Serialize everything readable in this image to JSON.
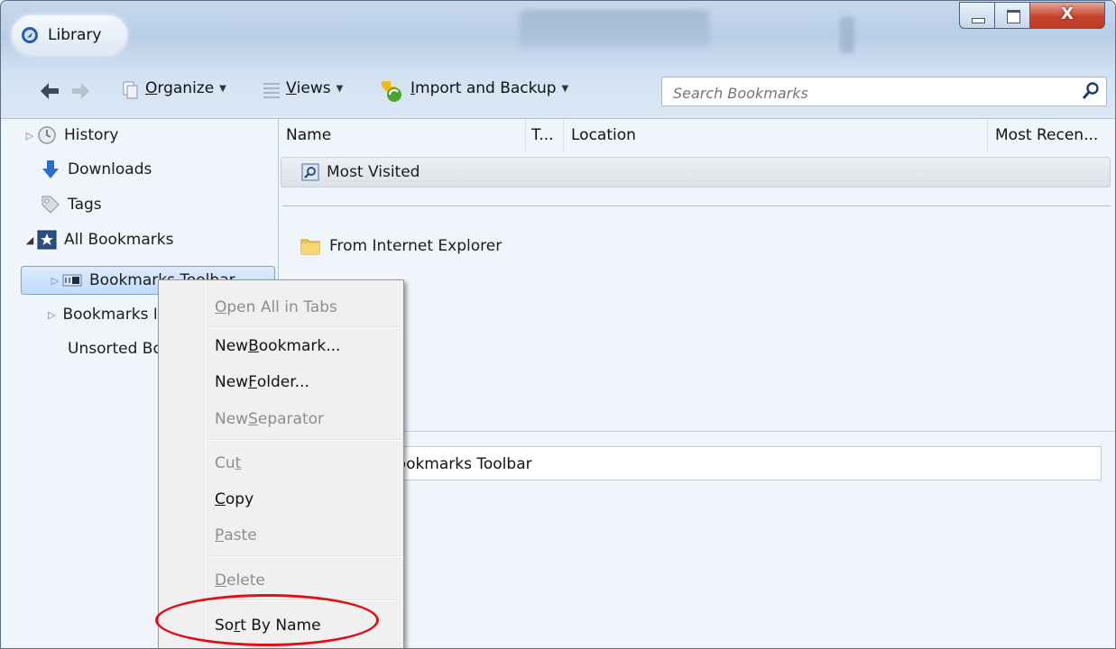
{
  "window": {
    "title": "Library",
    "controls": {
      "minimize": "minimize",
      "maximize": "maximize",
      "close": "X"
    }
  },
  "toolbar": {
    "organize": {
      "pre": "",
      "key": "O",
      "post": "rganize"
    },
    "views": {
      "pre": "",
      "key": "V",
      "post": "iews"
    },
    "import_backup": {
      "pre": "",
      "key": "I",
      "post": "mport and Backup"
    },
    "search_placeholder": "Search Bookmarks"
  },
  "sidebar": {
    "items": [
      {
        "label": "History"
      },
      {
        "label": "Downloads"
      },
      {
        "label": "Tags"
      },
      {
        "label": "All Bookmarks"
      },
      {
        "label": "Bookmarks Toolbar",
        "selected": true
      },
      {
        "label": "Bookmarks Menu"
      },
      {
        "label": "Unsorted Bookmarks"
      }
    ]
  },
  "columns": {
    "name": "Name",
    "tags": "T...",
    "location": "Location",
    "most_recent": "Most Recen..."
  },
  "rows": [
    {
      "name": "Most Visited"
    },
    {
      "name": "From Internet Explorer"
    }
  ],
  "details": {
    "name_value": "Bookmarks Toolbar"
  },
  "context_menu": {
    "open_all": {
      "pre": "",
      "key": "O",
      "post": "pen All in Tabs"
    },
    "new_bookmark": {
      "pre": "New ",
      "key": "B",
      "post": "ookmark..."
    },
    "new_folder": {
      "pre": "New ",
      "key": "F",
      "post": "older..."
    },
    "new_separator": {
      "pre": "New ",
      "key": "S",
      "post": "eparator"
    },
    "cut": {
      "pre": "Cu",
      "key": "t",
      "post": ""
    },
    "copy": {
      "pre": "",
      "key": "C",
      "post": "opy"
    },
    "paste": {
      "pre": "",
      "key": "P",
      "post": "aste"
    },
    "delete": {
      "pre": "",
      "key": "D",
      "post": "elete"
    },
    "sort_by_name": {
      "pre": "So",
      "key": "r",
      "post": "t By Name"
    }
  },
  "colors": {
    "highlight": "#e01018",
    "selection": "#c1dcfc"
  }
}
